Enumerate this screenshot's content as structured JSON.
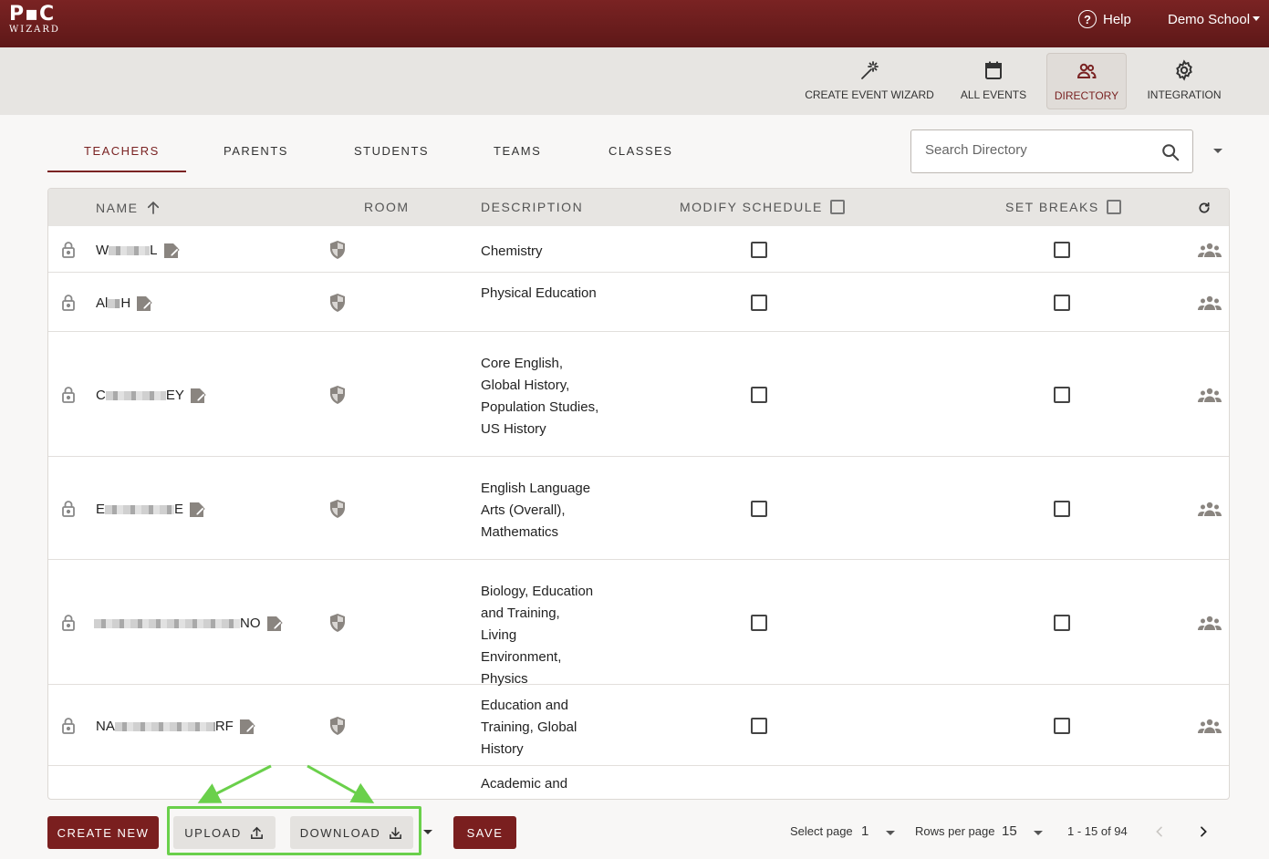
{
  "app": {
    "logo_top": "P▪C",
    "logo_sub": "WIZARD",
    "help_label": "Help",
    "school_label": "Demo School"
  },
  "nav": {
    "items": [
      {
        "label": "CREATE EVENT WIZARD",
        "icon": "magic-wand-icon"
      },
      {
        "label": "ALL EVENTS",
        "icon": "calendar-icon"
      },
      {
        "label": "DIRECTORY",
        "icon": "people-icon",
        "active": true
      },
      {
        "label": "INTEGRATION",
        "icon": "gear-icon"
      }
    ]
  },
  "tabs": [
    {
      "label": "TEACHERS",
      "active": true
    },
    {
      "label": "PARENTS"
    },
    {
      "label": "STUDENTS"
    },
    {
      "label": "TEAMS"
    },
    {
      "label": "CLASSES"
    }
  ],
  "search": {
    "placeholder": "Search Directory"
  },
  "table": {
    "headers": {
      "name": "NAME",
      "room": "ROOM",
      "description": "DESCRIPTION",
      "modify_schedule": "MODIFY SCHEDULE",
      "set_breaks": "SET BREAKS"
    },
    "rows": [
      {
        "name_start": "W",
        "name_end": "L",
        "description": "Chemistry"
      },
      {
        "name_start": "Al",
        "name_end": "H",
        "description": "Physical Education"
      },
      {
        "name_start": "C",
        "name_end": "EY",
        "description": "Core English, Global History, Population Studies, US History"
      },
      {
        "name_start": "E",
        "name_end": "E",
        "description": "English Language Arts (Overall), Mathematics"
      },
      {
        "name_start": "",
        "name_end": "NO",
        "description": "Biology, Education and Training, Living Environment, Physics"
      },
      {
        "name_start": "NA",
        "name_end": "RF",
        "description": "Education and Training, Global History"
      },
      {
        "name_start": "",
        "name_end": "",
        "description": "Academic and Personal"
      }
    ]
  },
  "footer": {
    "create_new": "CREATE NEW",
    "upload": "UPLOAD",
    "download": "DOWNLOAD",
    "save": "SAVE",
    "select_page_label": "Select page",
    "select_page_value": "1",
    "rows_per_page_label": "Rows per page",
    "rows_per_page_value": "15",
    "range": "1 - 15 of 94"
  },
  "colors": {
    "brand": "#7a2323",
    "highlight": "#6ad04b"
  }
}
